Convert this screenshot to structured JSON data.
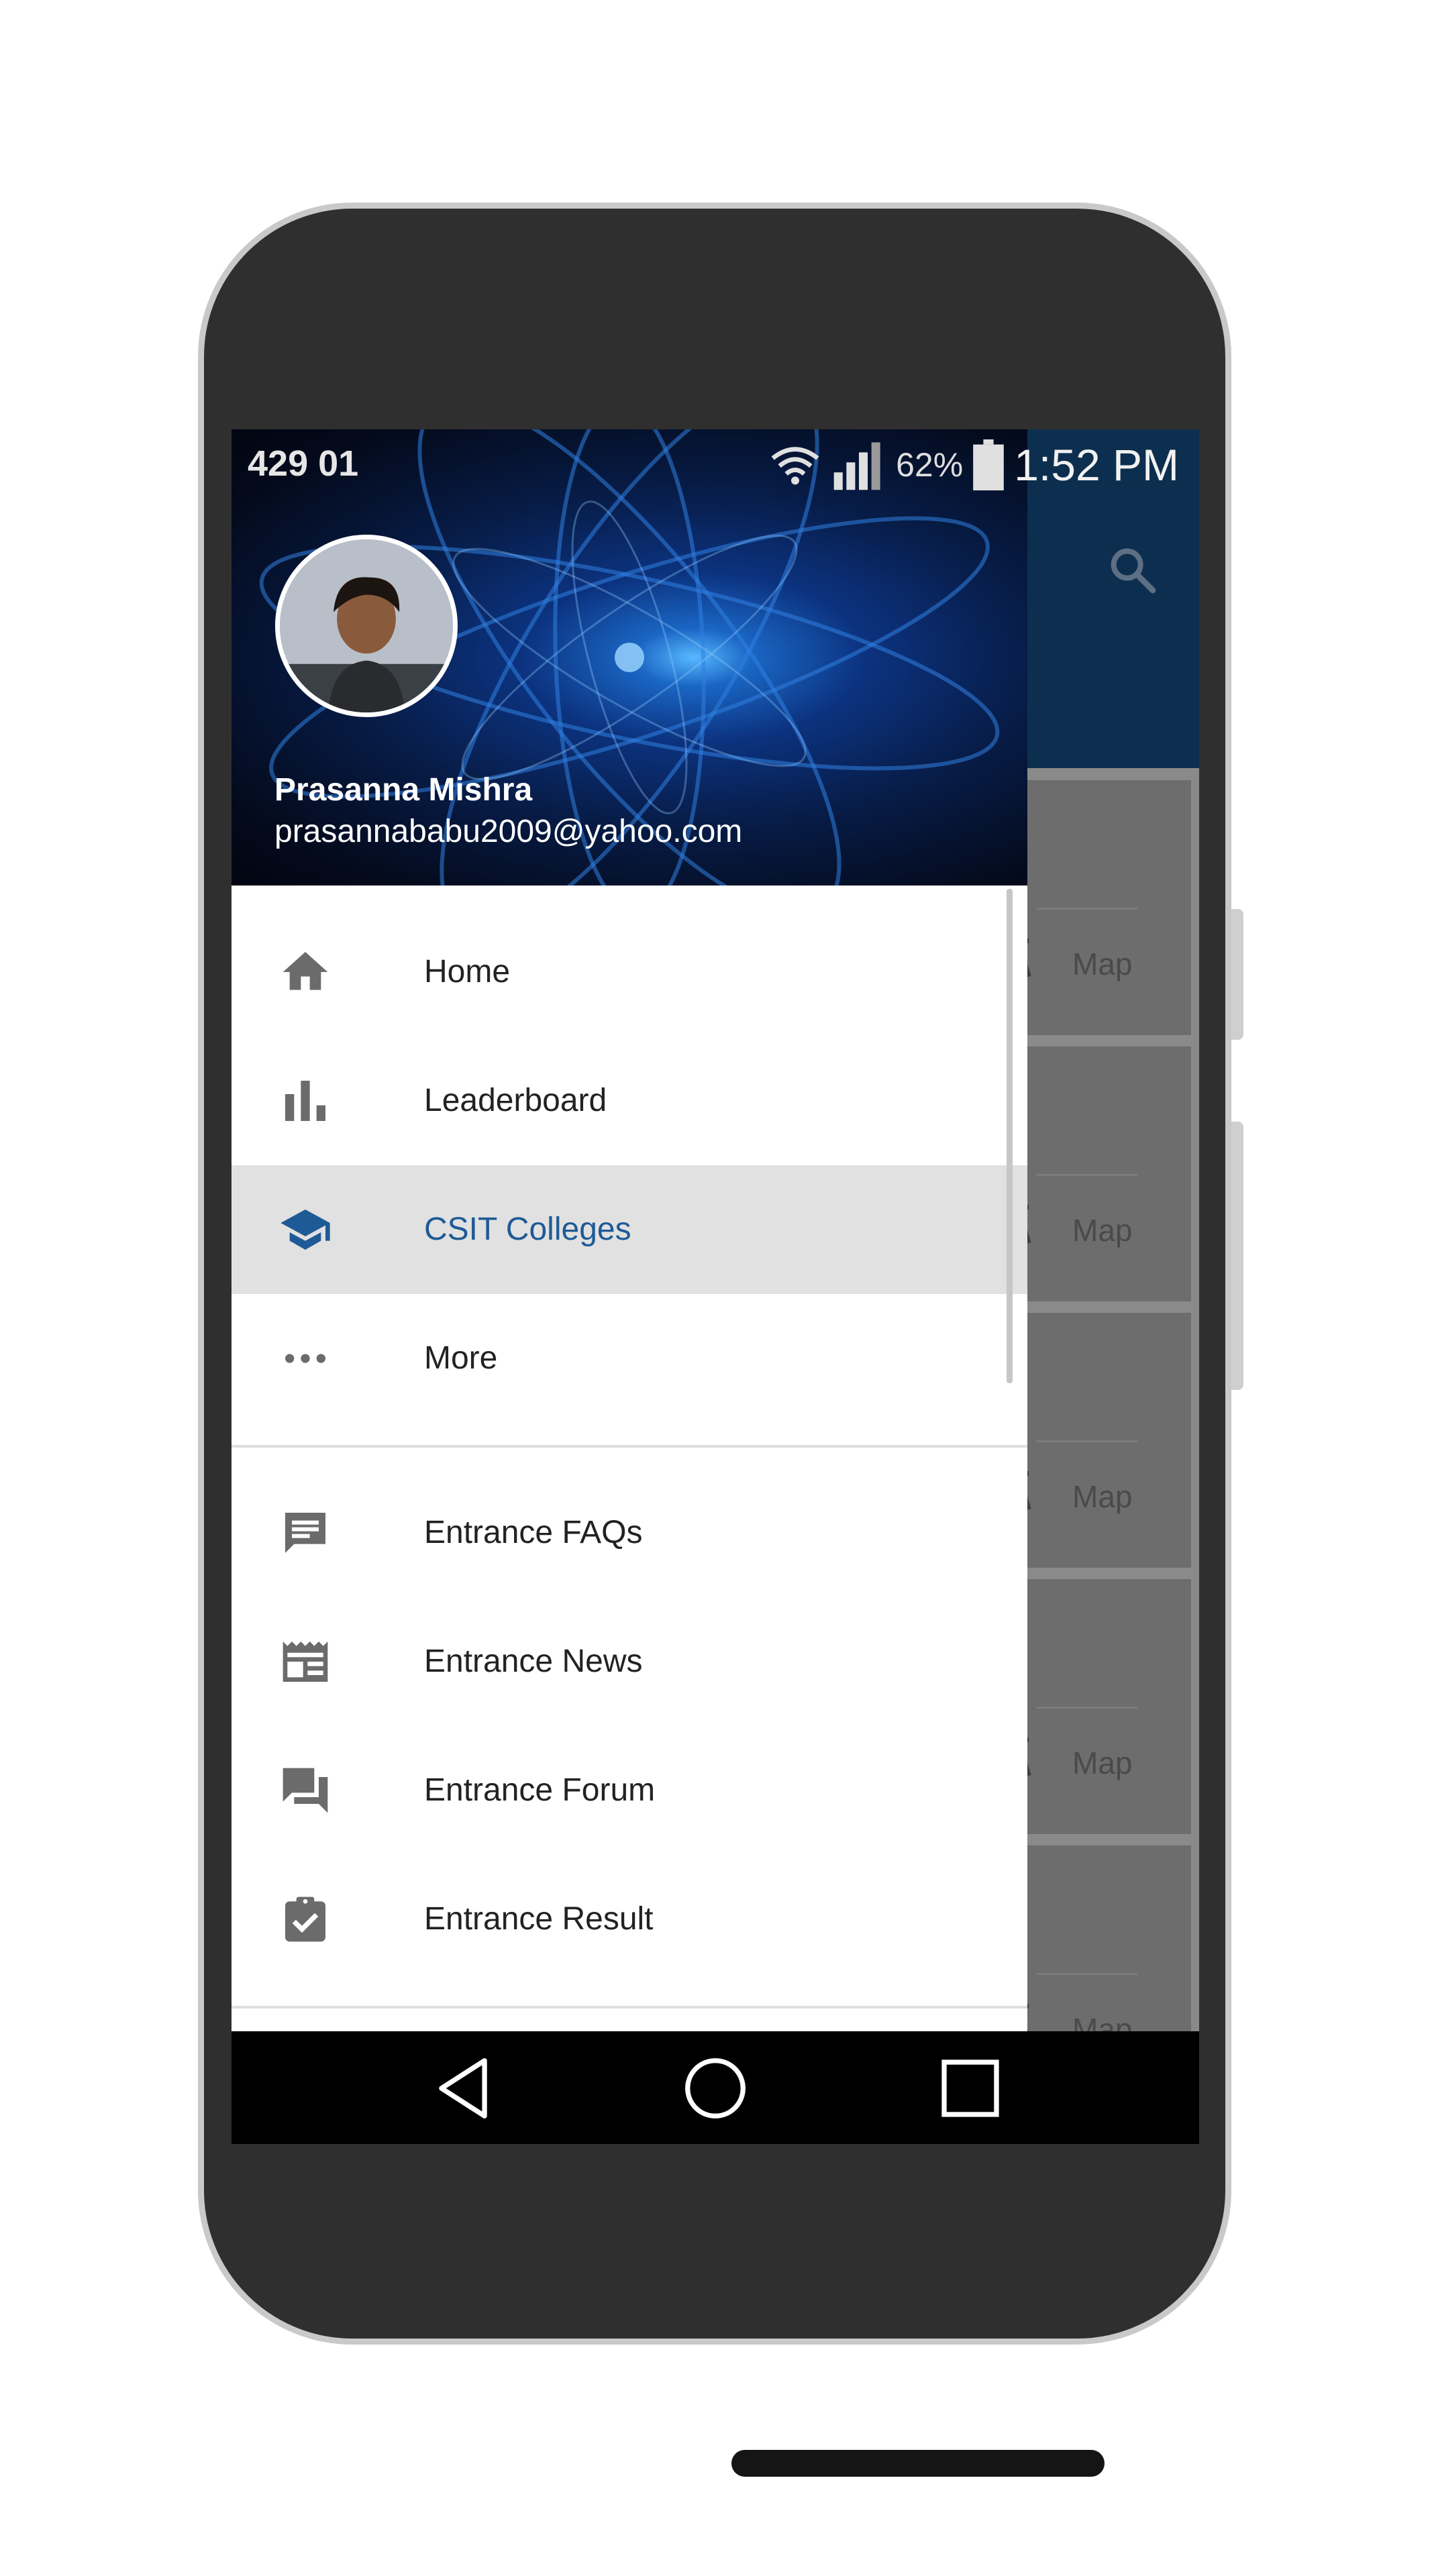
{
  "status_bar": {
    "carrier": "429 01",
    "battery_percent": "62%",
    "time": "1:52 PM"
  },
  "background_app": {
    "cards": [
      {
        "map_label": "Map"
      },
      {
        "map_label": "Map"
      },
      {
        "map_label": "Map"
      },
      {
        "map_label": "Map"
      },
      {
        "map_label": "Map"
      }
    ]
  },
  "drawer": {
    "user": {
      "name": "Prasanna Mishra",
      "email": "prasannababu2009@yahoo.com"
    },
    "primary_items": [
      {
        "label": "Home",
        "icon": "home-icon",
        "active": false
      },
      {
        "label": "Leaderboard",
        "icon": "leaderboard-icon",
        "active": false
      },
      {
        "label": "CSIT Colleges",
        "icon": "school-icon",
        "active": true
      },
      {
        "label": "More",
        "icon": "more-icon",
        "active": false
      }
    ],
    "secondary_items": [
      {
        "label": "Entrance FAQs",
        "icon": "faq-icon"
      },
      {
        "label": "Entrance News",
        "icon": "news-icon"
      },
      {
        "label": "Entrance Forum",
        "icon": "forum-icon"
      },
      {
        "label": "Entrance Result",
        "icon": "result-icon"
      }
    ]
  },
  "colors": {
    "app_bar": "#0d2f4f",
    "active_text": "#1e5a96",
    "icon_gray": "#6b6b6b",
    "scrim_card": "#6d6d6d"
  }
}
